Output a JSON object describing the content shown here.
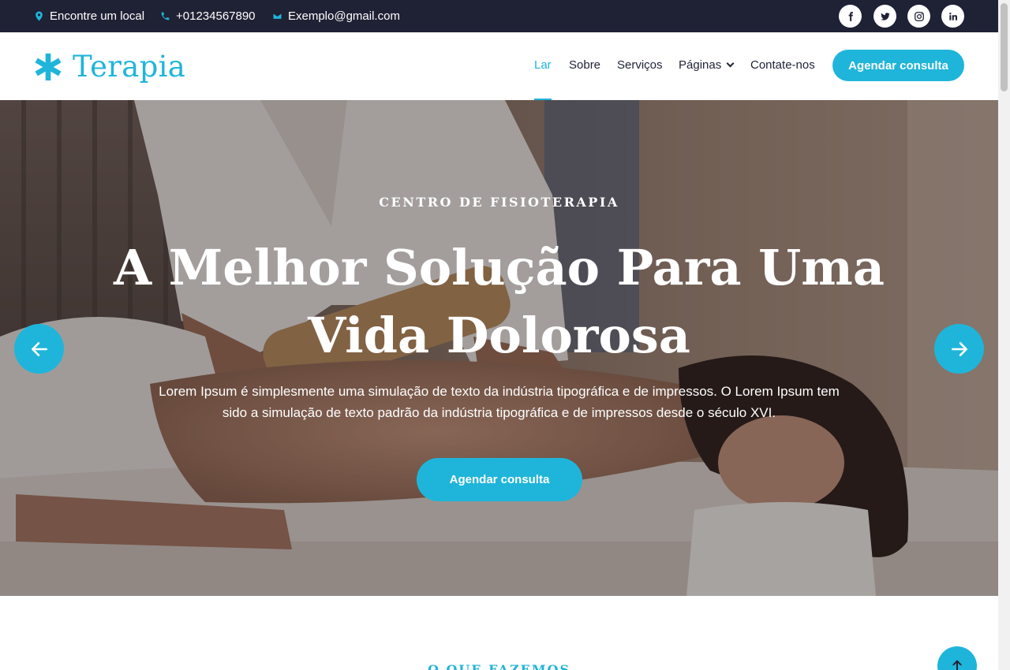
{
  "topbar": {
    "location": "Encontre um local",
    "phone": "+01234567890",
    "email": "Exemplo@gmail.com",
    "social": [
      "facebook",
      "twitter",
      "instagram",
      "linkedin"
    ]
  },
  "brand": {
    "name": "Terapia",
    "accent_color": "#1fb5da",
    "dark_color": "#1f2135"
  },
  "nav": {
    "items": [
      {
        "label": "Lar",
        "active": true
      },
      {
        "label": "Sobre"
      },
      {
        "label": "Serviços"
      },
      {
        "label": "Páginas",
        "dropdown": true
      },
      {
        "label": "Contate-nos"
      }
    ],
    "cta": "Agendar consulta"
  },
  "hero": {
    "kicker": "CENTRO DE FISIOTERAPIA",
    "title": "A Melhor Solução Para Uma Vida Dolorosa",
    "description": "Lorem Ipsum é simplesmente uma simulação de texto da indústria tipográfica e de impressos. O Lorem Ipsum tem sido a simulação de texto padrão da indústria tipográfica e de impressos desde o século XVI.",
    "cta": "Agendar consulta"
  },
  "next_section": {
    "label": "O QUE FAZEMOS"
  }
}
